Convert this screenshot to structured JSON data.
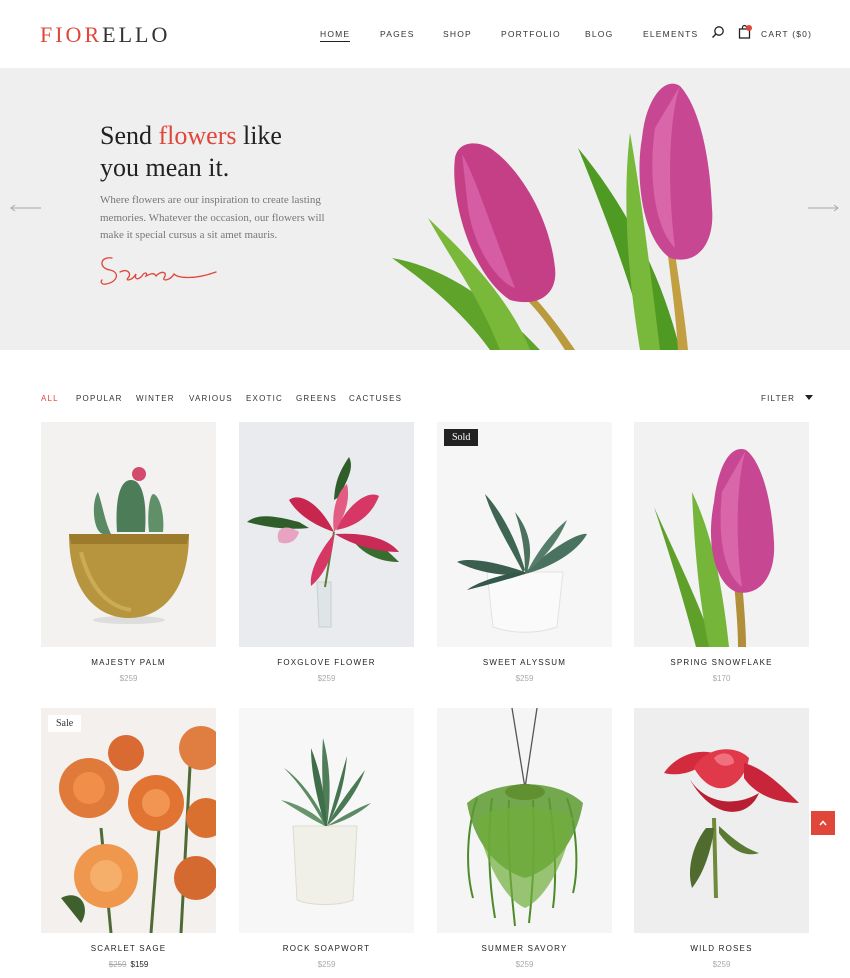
{
  "brand": {
    "logo_red": "FIOR",
    "logo_dark": "ELLO"
  },
  "nav": {
    "items": [
      "HOME",
      "PAGES",
      "SHOP",
      "PORTFOLIO",
      "BLOG",
      "ELEMENTS"
    ],
    "active": "HOME",
    "search_icon": "search-icon",
    "cart_icon": "shopping-bag-icon",
    "cart_label": "CART ($0)"
  },
  "hero": {
    "title_line1_pre": "Send ",
    "title_highlight": "flowers",
    "title_line1_post": " like",
    "title_line2": "you mean it.",
    "text": "Where flowers are our inspiration to create lasting memories. Whatever the occasion, our flowers will make it special cursus a sit amet mauris.",
    "signature": "Sara",
    "prev_icon": "arrow-left-icon",
    "next_icon": "arrow-right-icon"
  },
  "filters": {
    "tabs": [
      "ALL",
      "POPULAR",
      "WINTER",
      "VARIOUS",
      "EXOTIC",
      "GREENS",
      "CACTUSES"
    ],
    "active": "ALL",
    "filter_label": "FILTER"
  },
  "products": [
    {
      "name": "MAJESTY PALM",
      "price": "$259",
      "badge": "",
      "image": "cactus-in-brass-pot"
    },
    {
      "name": "FOXGLOVE FLOWER",
      "price": "$259",
      "badge": "",
      "image": "pink-lily"
    },
    {
      "name": "SWEET ALYSSUM",
      "price": "$259",
      "badge": "Sold",
      "image": "succulent-white-pot"
    },
    {
      "name": "SPRING SNOWFLAKE",
      "price": "$170",
      "badge": "",
      "image": "pink-tulip"
    },
    {
      "name": "SCARLET SAGE",
      "price": "$159",
      "old_price": "$259",
      "badge": "Sale",
      "image": "orange-roses"
    },
    {
      "name": "ROCK SOAPWORT",
      "price": "$259",
      "badge": "",
      "image": "aloe-white-pot"
    },
    {
      "name": "SUMMER SAVORY",
      "price": "$259",
      "badge": "",
      "image": "hanging-fern"
    },
    {
      "name": "WILD ROSES",
      "price": "$259",
      "badge": "",
      "image": "red-rose"
    }
  ],
  "scroll_top_icon": "chevron-up-icon",
  "colors": {
    "accent": "#e0463a",
    "hero_bg": "#efefef",
    "text_dark": "#222222",
    "text_muted": "#777777"
  }
}
